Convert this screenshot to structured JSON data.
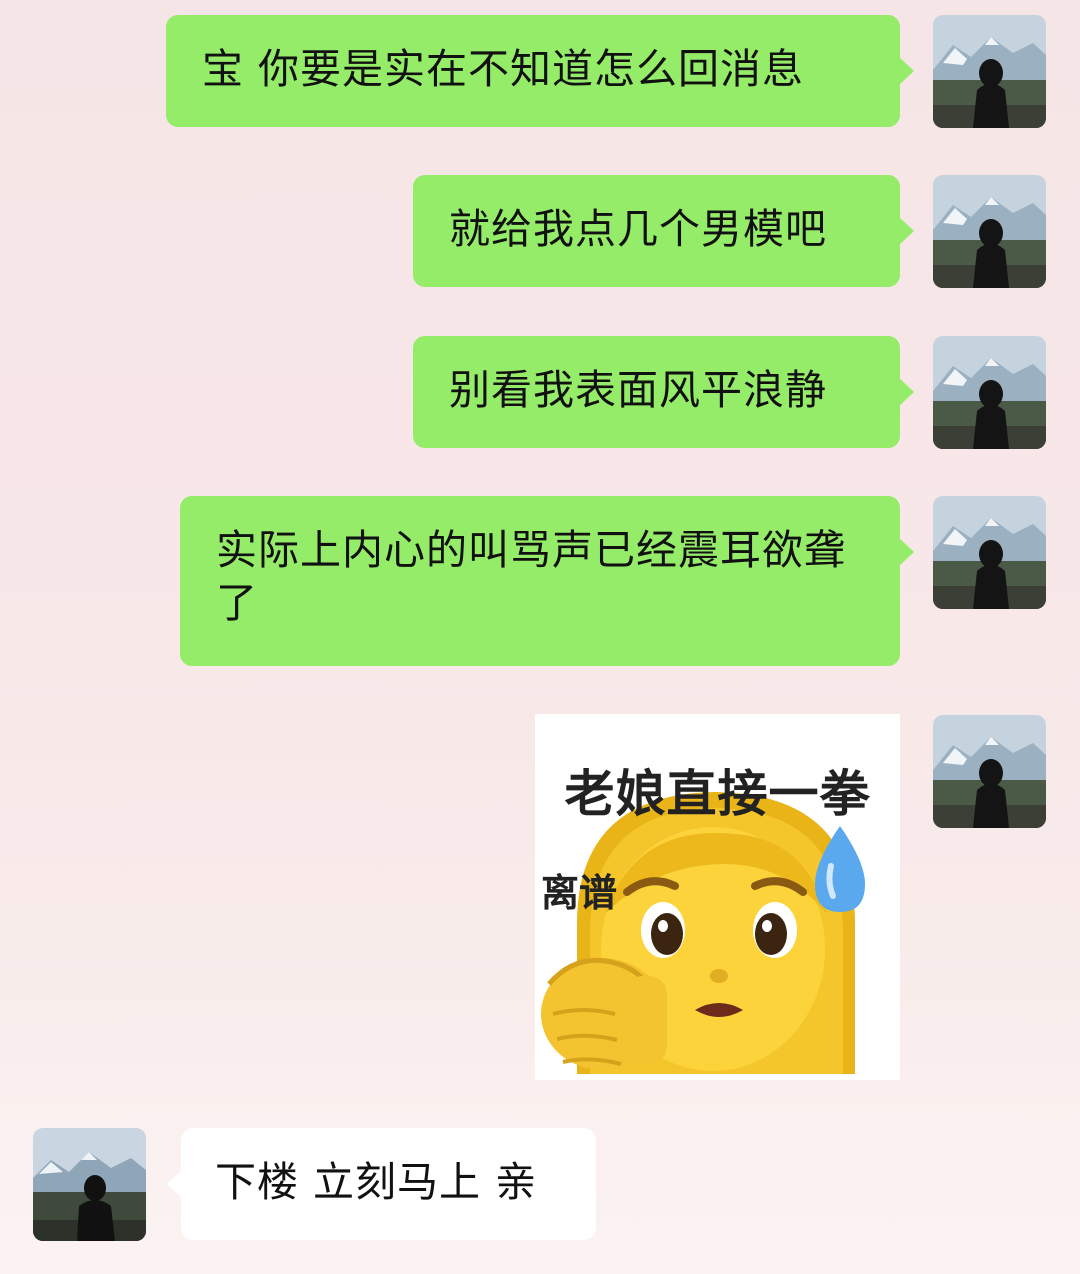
{
  "messages": [
    {
      "side": "sent",
      "text": "宝 你要是实在不知道怎么回消息"
    },
    {
      "side": "sent",
      "text": "就给我点几个男模吧"
    },
    {
      "side": "sent",
      "text": "别看我表面风平浪静"
    },
    {
      "side": "sent",
      "text": "实际上内心的叫骂声已经震耳欲聋了"
    },
    {
      "side": "sent",
      "type": "sticker",
      "sticker_top_text": "老娘直接一拳",
      "sticker_side_text": "离谱",
      "sticker_icon": "woman-punch-sweat-emoji"
    },
    {
      "side": "received",
      "text": "下楼 立刻马上 亲"
    }
  ],
  "colors": {
    "sent_bubble": "#95ec69",
    "received_bubble": "#ffffff",
    "background": "#f6e5e6"
  }
}
